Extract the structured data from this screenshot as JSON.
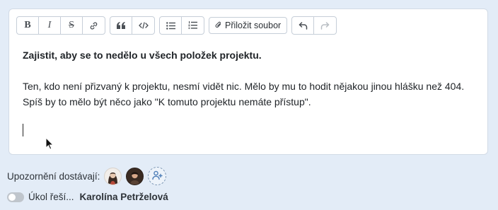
{
  "toolbar": {
    "bold_label": "B",
    "italic_label": "I",
    "strike_label": "S",
    "attach_label": "Přiložit soubor",
    "icons": [
      "bold-icon",
      "italic-icon",
      "strikethrough-icon",
      "link-icon",
      "quote-icon",
      "code-icon",
      "bullet-list-icon",
      "numbered-list-icon",
      "paperclip-icon",
      "undo-icon",
      "redo-icon"
    ]
  },
  "editor": {
    "heading": "Zajistit, aby se to nedělo u všech položek projektu.",
    "paragraph": "Ten, kdo není přizvaný k projektu, nesmí vidět nic. Mělo by mu to hodit nějakou jinou hlášku než 404. Spíš by to mělo být něco jako \"K tomuto projektu nemáte přístup\"."
  },
  "watchers": {
    "label": "Upozornění dostávají:"
  },
  "task": {
    "label": "Úkol řeší...",
    "assignee": "Karolína Petrželová",
    "enabled": false
  },
  "colors": {
    "page_background": "#e3ecf7",
    "editor_background": "#ffffff",
    "add_button_accent": "#4f7fb8"
  }
}
